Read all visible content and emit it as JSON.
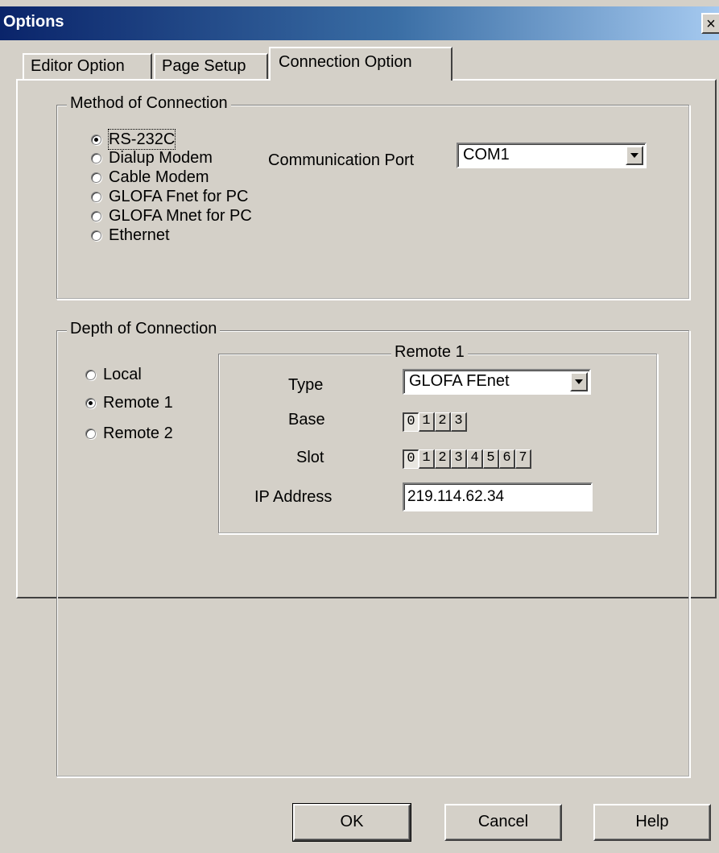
{
  "window": {
    "title": "Options",
    "close_glyph": "×"
  },
  "tabs": [
    {
      "label": "Editor Option",
      "active": false
    },
    {
      "label": "Page Setup",
      "active": false
    },
    {
      "label": "Connection Option",
      "active": true
    }
  ],
  "method_group": {
    "legend": "Method of Connection",
    "options": [
      {
        "label": "RS-232C",
        "checked": true
      },
      {
        "label": "Dialup Modem",
        "checked": false
      },
      {
        "label": "Cable Modem",
        "checked": false
      },
      {
        "label": "GLOFA Fnet for PC",
        "checked": false
      },
      {
        "label": "GLOFA Mnet for PC",
        "checked": false
      },
      {
        "label": "Ethernet",
        "checked": false
      }
    ],
    "port_label": "Communication Port",
    "port_value": "COM1"
  },
  "depth_group": {
    "legend": "Depth of Connection",
    "options": [
      {
        "label": "Local",
        "checked": false
      },
      {
        "label": "Remote 1",
        "checked": true
      },
      {
        "label": "Remote 2",
        "checked": false
      }
    ]
  },
  "remote_group": {
    "legend": "Remote 1",
    "type_label": "Type",
    "type_value": "GLOFA FEnet",
    "base_label": "Base",
    "base_options": [
      "0",
      "1",
      "2",
      "3"
    ],
    "base_selected": "0",
    "slot_label": "Slot",
    "slot_options": [
      "0",
      "1",
      "2",
      "3",
      "4",
      "5",
      "6",
      "7"
    ],
    "slot_selected": "0",
    "ip_label": "IP Address",
    "ip_value": "219.114.62.34"
  },
  "buttons": {
    "ok": "OK",
    "cancel": "Cancel",
    "help": "Help"
  },
  "icons": {
    "dropdown": "chevron-down-icon",
    "close": "close-icon"
  }
}
